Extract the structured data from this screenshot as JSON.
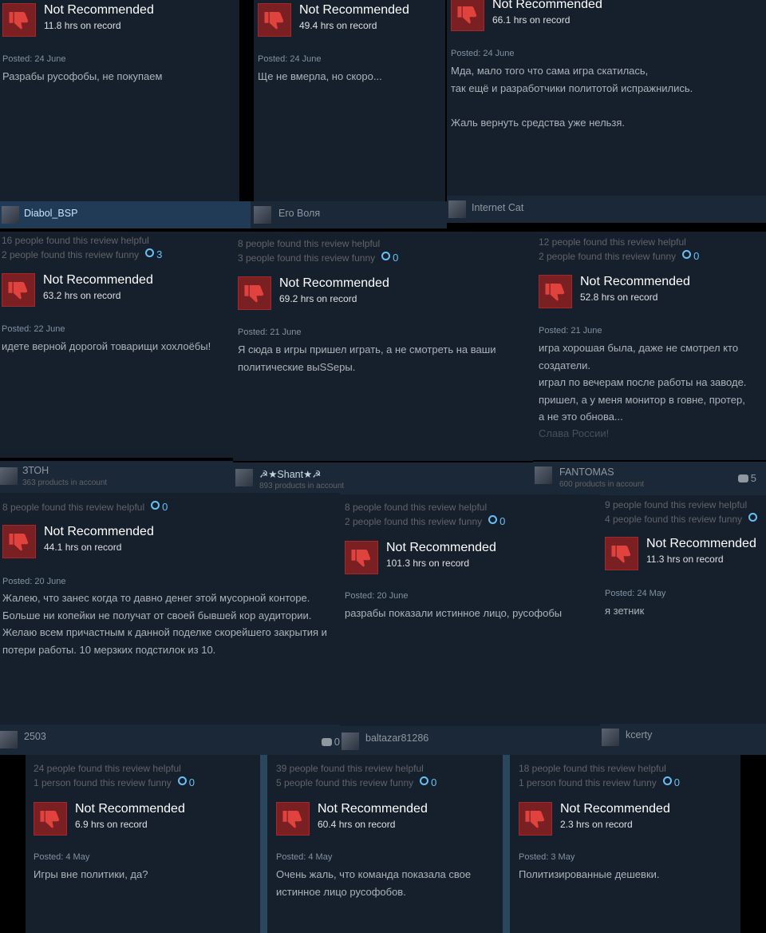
{
  "recommendation_label": "Not Recommended",
  "reviews": [
    {
      "hours": "11.8 hrs on record",
      "posted": "Posted: 24 June",
      "body": "Разрабы русофобы, не покупаем"
    },
    {
      "hours": "49.4 hrs on record",
      "posted": "Posted: 24 June",
      "body": "Ще не вмерла, но скоро..."
    },
    {
      "hours": "66.1 hrs on record",
      "posted": "Posted: 24 June",
      "body": "Мда, мало того что сама игра скатилась,\nтак ещё и разработчики политотой испражнились.\n\nЖаль вернуть средства уже нельзя."
    },
    {
      "author": "Diabol_BSP",
      "helpful": "16 people found this review helpful",
      "funny": "2 people found this review funny",
      "awards": "3",
      "hours": "63.2 hrs on record",
      "posted": "Posted: 22 June",
      "body": "идете верной дорогой товарищи хохлоёбы!"
    },
    {
      "author": "Его Воля",
      "helpful": "8 people found this review helpful",
      "funny": "3 people found this review funny",
      "awards": "0",
      "hours": "69.2 hrs on record",
      "posted": "Posted: 21 June",
      "body": "Я сюда в игры пришел играть, а не смотреть на ваши\nполитические выSSеры."
    },
    {
      "author": "Internet Cat",
      "helpful": "12 people found this review helpful",
      "funny": "2 people found this review funny",
      "awards": "0",
      "hours": "52.8 hrs on record",
      "posted": "Posted: 21 June",
      "body": "игра хорошая была, даже не смотрел кто\nсоздатели.\nиграл по вечерам после работы на заводе.\nпришел, а у меня монитор в говне, протер,\nа не это обнова...",
      "body_fade": "Слава России!"
    },
    {
      "author": "ЗТОН",
      "products": "363 products in account",
      "helpful": "8 people found this review helpful",
      "awards": "0",
      "hours": "44.1 hrs on record",
      "posted": "Posted: 20 June",
      "body": "Жалею, что занес когда то давно денег этой мусорной конторе.\nБольше ни копейки не получат от своей бывшей кор аудитории.\nЖелаю всем причастным к данной поделке скорейшего закрытия и\nпотери работы. 10 мерзких подстилок из 10."
    },
    {
      "author": "☭★Shant★☭",
      "products": "893 products in account",
      "helpful": "8 people found this review helpful",
      "funny": "2 people found this review funny",
      "awards": "0",
      "hours": "101.3 hrs on record",
      "posted": "Posted: 20 June",
      "body": "разрабы показали истинное лицо, русофобы"
    },
    {
      "author": "FANTOMAS",
      "products": "600 products in account",
      "comments": "5",
      "helpful": "9 people found this review helpful",
      "funny": "4 people found this review funny",
      "awards": "",
      "hours": "11.3 hrs on record",
      "posted": "Posted: 24 May",
      "body": "я зетник"
    },
    {
      "author": "2503",
      "comments": "0",
      "helpful": "24 people found this review helpful",
      "funny": "1 person found this review funny",
      "awards": "0",
      "hours": "6.9 hrs on record",
      "posted": "Posted: 4 May",
      "body": "Игры вне политики, да?"
    },
    {
      "author": "baltazar81286",
      "helpful": "39 people found this review helpful",
      "funny": "5 people found this review funny",
      "awards": "0",
      "hours": "60.4 hrs on record",
      "posted": "Posted: 4 May",
      "body": "Очень жаль, что команда показала свое\nистинное лицо русофобов."
    },
    {
      "author": "kcerty",
      "helpful": "18 people found this review helpful",
      "funny": "1 person found this review funny",
      "awards": "0",
      "hours": "2.3 hrs on record",
      "posted": "Posted: 3 May",
      "body": "Политизированные дешевки."
    }
  ]
}
